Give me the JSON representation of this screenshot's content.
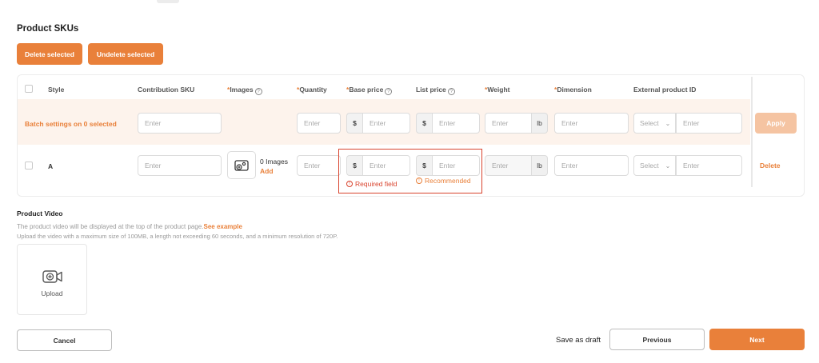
{
  "section_title": "Product SKUs",
  "actions": {
    "delete_selected": "Delete selected",
    "undelete_selected": "Undelete selected"
  },
  "columns": {
    "style": "Style",
    "contribution_sku": "Contribution SKU",
    "images": "Images",
    "quantity": "Quantity",
    "base_price": "Base price",
    "list_price": "List price",
    "weight": "Weight",
    "dimension": "Dimension",
    "external_product_id": "External product ID",
    "required_mark": "*",
    "help_icon": "?"
  },
  "batch": {
    "label": "Batch settings on 0 selected",
    "placeholder": "Enter",
    "currency": "$",
    "weight_unit": "lb",
    "select_placeholder": "Select",
    "apply": "Apply"
  },
  "row": {
    "style": "A",
    "placeholder": "Enter",
    "currency": "$",
    "weight_unit": "lb",
    "select_placeholder": "Select",
    "images_count": "0 Images",
    "images_add": "Add",
    "delete": "Delete",
    "base_price_error": "Required field",
    "list_price_hint": "Recommended",
    "error_icon": "!"
  },
  "video": {
    "title": "Product Video",
    "desc1": "The product video will be displayed at the top of the product page.",
    "see_example": "See example",
    "desc2": "Upload the video with a maximum size of 100MB, a length not exceeding 60 seconds, and a minimum resolution of 720P.",
    "upload": "Upload"
  },
  "footer": {
    "cancel": "Cancel",
    "save_draft": "Save as draft",
    "previous": "Previous",
    "next": "Next"
  },
  "colors": {
    "accent": "#e9803a",
    "accent_light": "#f5c4a2",
    "batch_bg": "#fdf3ec",
    "error": "#d9442e"
  },
  "icons": {
    "image": "image-icon",
    "video": "video-add-icon",
    "help": "help-icon",
    "chevron": "chevron-down-icon"
  }
}
